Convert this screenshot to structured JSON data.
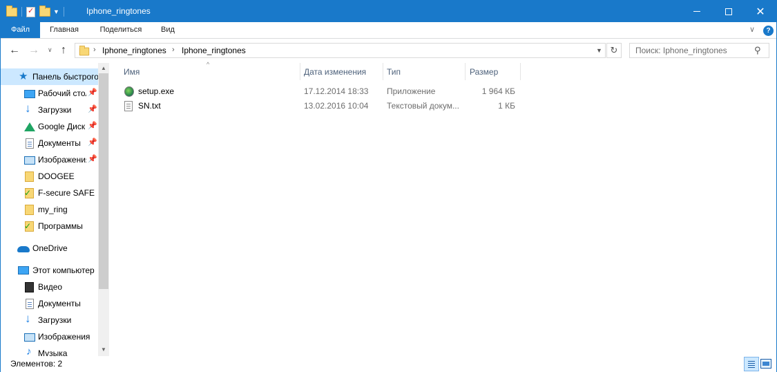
{
  "window": {
    "title": "Iphone_ringtones",
    "min_icon": "minimize-icon",
    "max_icon": "maximize-icon",
    "close_glyph": "✕"
  },
  "ribbon": {
    "tabs": [
      "Файл",
      "Главная",
      "Поделиться",
      "Вид"
    ],
    "expand_glyph": "∨",
    "help_glyph": "?"
  },
  "nav": {
    "back_glyph": "←",
    "forward_glyph": "→",
    "recent_glyph": "∨",
    "up_glyph": "↑",
    "chevron": "›",
    "breadcrumb": [
      "Iphone_ringtones",
      "Iphone_ringtones"
    ],
    "refresh_glyph": "↻",
    "search_placeholder": "Поиск: Iphone_ringtones",
    "search_glyph": "⚲"
  },
  "sidebar": {
    "pin_glyph": "📌",
    "items": [
      {
        "label": "Панель быстрого доступа",
        "icon": "star-icon"
      },
      {
        "label": "Рабочий стол",
        "icon": "desktop-icon"
      },
      {
        "label": "Загрузки",
        "icon": "download-icon"
      },
      {
        "label": "Google Диск",
        "icon": "google-drive-icon"
      },
      {
        "label": "Документы",
        "icon": "documents-icon"
      },
      {
        "label": "Изображения",
        "icon": "images-icon"
      },
      {
        "label": "DOOGEE",
        "icon": "folder-icon"
      },
      {
        "label": "F-secure SAFE",
        "icon": "synced-folder-icon"
      },
      {
        "label": "my_ring",
        "icon": "folder-icon"
      },
      {
        "label": "Программы",
        "icon": "synced-folder-icon"
      },
      {
        "label": "OneDrive",
        "icon": "onedrive-cloud-icon"
      },
      {
        "label": "Этот компьютер",
        "icon": "computer-icon"
      },
      {
        "label": "Видео",
        "icon": "video-icon"
      },
      {
        "label": "Документы",
        "icon": "documents-icon"
      },
      {
        "label": "Загрузки",
        "icon": "download-icon"
      },
      {
        "label": "Изображения",
        "icon": "images-icon"
      },
      {
        "label": "Музыка",
        "icon": "music-icon"
      }
    ]
  },
  "columns": {
    "name": "Имя",
    "date": "Дата изменения",
    "type": "Тип",
    "size": "Размер",
    "sort_glyph": "^"
  },
  "files": [
    {
      "name": "setup.exe",
      "date": "17.12.2014 18:33",
      "type": "Приложение",
      "size": "1 964 КБ",
      "icon": "application-icon"
    },
    {
      "name": "SN.txt",
      "date": "13.02.2016 10:04",
      "type": "Текстовый докум...",
      "size": "1 КБ",
      "icon": "text-file-icon"
    }
  ],
  "status": {
    "items_count": "Элементов: 2"
  },
  "colors": {
    "accent": "#1979ca",
    "selection": "#cce8ff"
  }
}
